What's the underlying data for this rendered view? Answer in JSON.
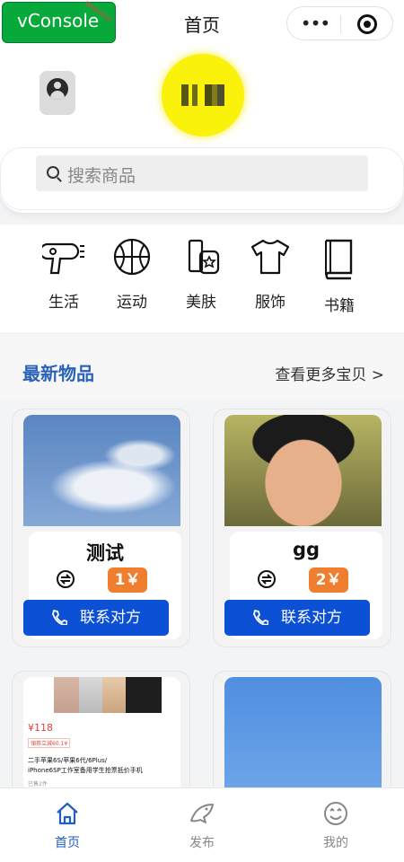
{
  "nav": {
    "title": "首页",
    "more_glyph": "•••"
  },
  "vconsole": {
    "label": "vConsole",
    "badge": "WEBVIEW"
  },
  "header": {
    "avatar_icon": "user-avatar-icon",
    "logo_icon": "yellow-circle-logo"
  },
  "search": {
    "placeholder": "搜索商品"
  },
  "categories": [
    {
      "label": "生活",
      "icon": "hair-dryer-icon"
    },
    {
      "label": "运动",
      "icon": "basketball-icon"
    },
    {
      "label": "美肤",
      "icon": "cosmetics-icon"
    },
    {
      "label": "服饰",
      "icon": "tshirt-icon"
    },
    {
      "label": "书籍",
      "icon": "book-icon"
    }
  ],
  "section": {
    "title": "最新物品",
    "more": "查看更多宝贝 >"
  },
  "products": [
    {
      "name": "测试",
      "price": "1￥",
      "contact": "联系对方",
      "image": "sky-cloud-photo"
    },
    {
      "name": "gg",
      "price": "2￥",
      "contact": "联系对方",
      "image": "cartoon-face-photo"
    }
  ],
  "partial_products": [
    {
      "price": "¥118",
      "tag": "領券立減60.1¥",
      "title_line1": "二手苹果6S/苹果6代/6Plus/",
      "title_line2": "iPhone6SP工作室备用学生抢票抵价手机",
      "sold": "已售2件",
      "image": "iphone-listing-photo"
    },
    {
      "image": "blue-sky-photo"
    }
  ],
  "tabs": [
    {
      "label": "首页",
      "icon": "home-icon",
      "active": true
    },
    {
      "label": "发布",
      "icon": "fish-icon",
      "active": false
    },
    {
      "label": "我的",
      "icon": "smiley-icon",
      "active": false
    }
  ],
  "colors": {
    "accent": "#2a62b8",
    "button": "#0c50d5",
    "price": "#ef7e2e",
    "vconsole": "#07a93b"
  }
}
